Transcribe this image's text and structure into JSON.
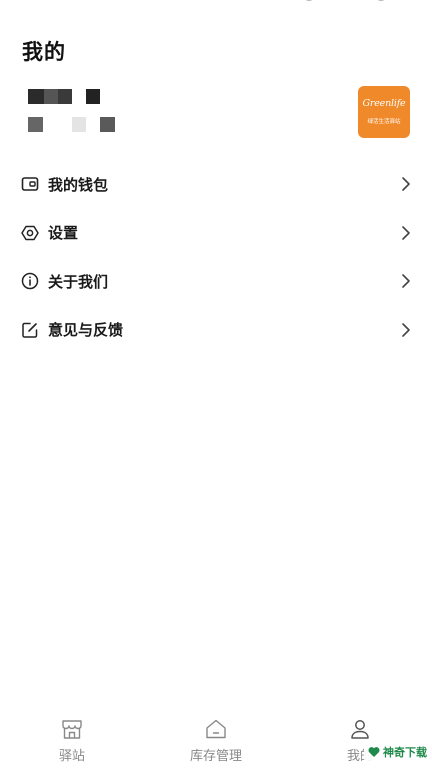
{
  "header": {
    "title": "我的"
  },
  "profile": {
    "avatar_logo_text": "Greenlife",
    "avatar_logo_subtext": "绿活生活驿站"
  },
  "menu": {
    "items": [
      {
        "label": "我的钱包",
        "icon": "wallet-icon"
      },
      {
        "label": "设置",
        "icon": "settings-hexagon-icon"
      },
      {
        "label": "关于我们",
        "icon": "info-icon"
      },
      {
        "label": "意见与反馈",
        "icon": "edit-feedback-icon"
      }
    ]
  },
  "tabbar": {
    "items": [
      {
        "label": "驿站",
        "icon": "store-icon"
      },
      {
        "label": "库存管理",
        "icon": "home-icon"
      },
      {
        "label": "我的",
        "icon": "person-icon"
      }
    ]
  },
  "watermark": {
    "text": "神奇下载"
  },
  "colors": {
    "avatar_bg": "#f0892a",
    "tab_inactive": "#888888",
    "text_primary": "#1a1a1a",
    "watermark_green": "#1f8a4c"
  }
}
